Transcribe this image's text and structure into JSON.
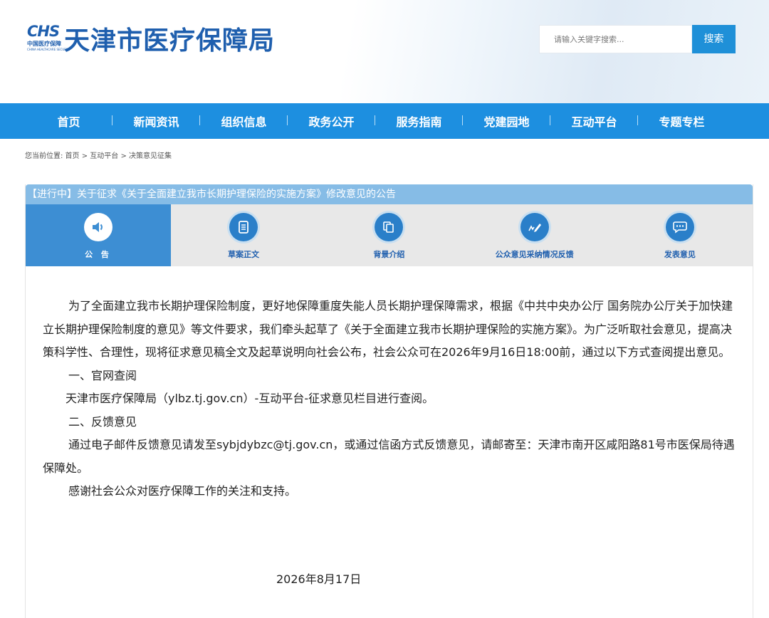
{
  "header": {
    "logo_chs": "CHS",
    "logo_cn": "中国医疗保障",
    "logo_en": "CHINA HEALTHCARE SECURITY",
    "site_title": "天津市医疗保障局",
    "search_placeholder": "请输入关键字搜索...",
    "search_button": "搜索"
  },
  "nav": [
    "首页",
    "新闻资讯",
    "组织信息",
    "政务公开",
    "服务指南",
    "党建园地",
    "互动平台",
    "专题专栏"
  ],
  "breadcrumb": "您当前位置:  首页 >  互动平台 > 决策意见征集",
  "panel": {
    "title": "【进行中】关于征求《关于全面建立我市长期护理保险的实施方案》修改意见的公告",
    "tabs": [
      {
        "label": "公 告",
        "icon": "speaker-icon"
      },
      {
        "label": "草案正文",
        "icon": "document-icon"
      },
      {
        "label": "背景介绍",
        "icon": "copy-icon"
      },
      {
        "label": "公众意见采纳情况反馈",
        "icon": "pen-icon"
      },
      {
        "label": "发表意见",
        "icon": "chat-icon"
      }
    ]
  },
  "content": {
    "p1": "为了全面建立我市长期护理保险制度，更好地保障重度失能人员长期护理保障需求，根据《中共中央办公厅 国务院办公厅关于加快建立长期护理保险制度的意见》等文件要求，我们牵头起草了《关于全面建立我市长期护理保险的实施方案》。为广泛听取社会意见，提高决策科学性、合理性，现将征求意见稿全文及起草说明向社会公布，社会公众可在2026年9月16日18:00前，通过以下方式查阅提出意见。",
    "h1": "一、官网查阅",
    "p2": "天津市医疗保障局（ylbz.tj.gov.cn）-互动平台-征求意见栏目进行查阅。",
    "h2": "二、反馈意见",
    "p3": "通过电子邮件反馈意见请发至sybjdybzc@tj.gov.cn，或通过信函方式反馈意见，请邮寄至：天津市南开区咸阳路81号市医保局待遇保障处。",
    "p4": "感谢社会公众对医疗保障工作的关注和支持。",
    "date": "2026年8月17日"
  },
  "colors": {
    "brand": "#1f5fae",
    "nav": "#1d8fe0",
    "active_tab": "#3d8ed3",
    "title_bar": "#86bce6"
  }
}
